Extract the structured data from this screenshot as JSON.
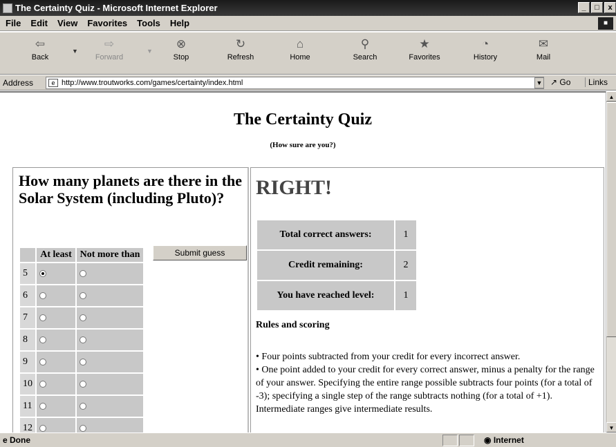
{
  "window": {
    "title": "The Certainty Quiz - Microsoft Internet Explorer",
    "controls": [
      "_",
      "□",
      "x"
    ]
  },
  "menu": [
    "File",
    "Edit",
    "View",
    "Favorites",
    "Tools",
    "Help"
  ],
  "toolbar": {
    "back": "Back",
    "forward": "Forward",
    "stop": "Stop",
    "refresh": "Refresh",
    "home": "Home",
    "search": "Search",
    "favorites": "Favorites",
    "history": "History",
    "mail": "Mail"
  },
  "address": {
    "label": "Address",
    "url": "http://www.troutworks.com/games/certainty/index.html",
    "go": "Go",
    "links": "Links"
  },
  "page": {
    "title": "The Certainty Quiz",
    "subtitle": "(How sure are you?)",
    "question": "How many planets are there in the Solar System (including Pluto)?",
    "table_headers": {
      "at_least": "At least",
      "not_more_than": "Not more than"
    },
    "rows": [
      {
        "n": "5",
        "at_least": true,
        "not_more": false
      },
      {
        "n": "6",
        "at_least": false,
        "not_more": false
      },
      {
        "n": "7",
        "at_least": false,
        "not_more": false
      },
      {
        "n": "8",
        "at_least": false,
        "not_more": false
      },
      {
        "n": "9",
        "at_least": false,
        "not_more": false
      },
      {
        "n": "10",
        "at_least": false,
        "not_more": false
      },
      {
        "n": "11",
        "at_least": false,
        "not_more": false
      },
      {
        "n": "12",
        "at_least": false,
        "not_more": false
      }
    ],
    "submit": "Submit guess",
    "verdict": "RIGHT!",
    "score": [
      {
        "label": "Total correct answers:",
        "value": "1"
      },
      {
        "label": "Credit remaining:",
        "value": "2"
      },
      {
        "label": "You have reached level:",
        "value": "1"
      }
    ],
    "rules_heading": "Rules and scoring",
    "rules": [
      "•  Four points subtracted from your credit for every incorrect answer.",
      "•  One point added to your credit for every correct answer, minus a penalty for the range of your answer. Specifying the entire range possible subtracts four points (for a total of -3); specifying a single step of the range subtracts nothing (for a total of +1). Intermediate ranges give intermediate results."
    ]
  },
  "status": {
    "text": "Done",
    "zone": "Internet"
  }
}
